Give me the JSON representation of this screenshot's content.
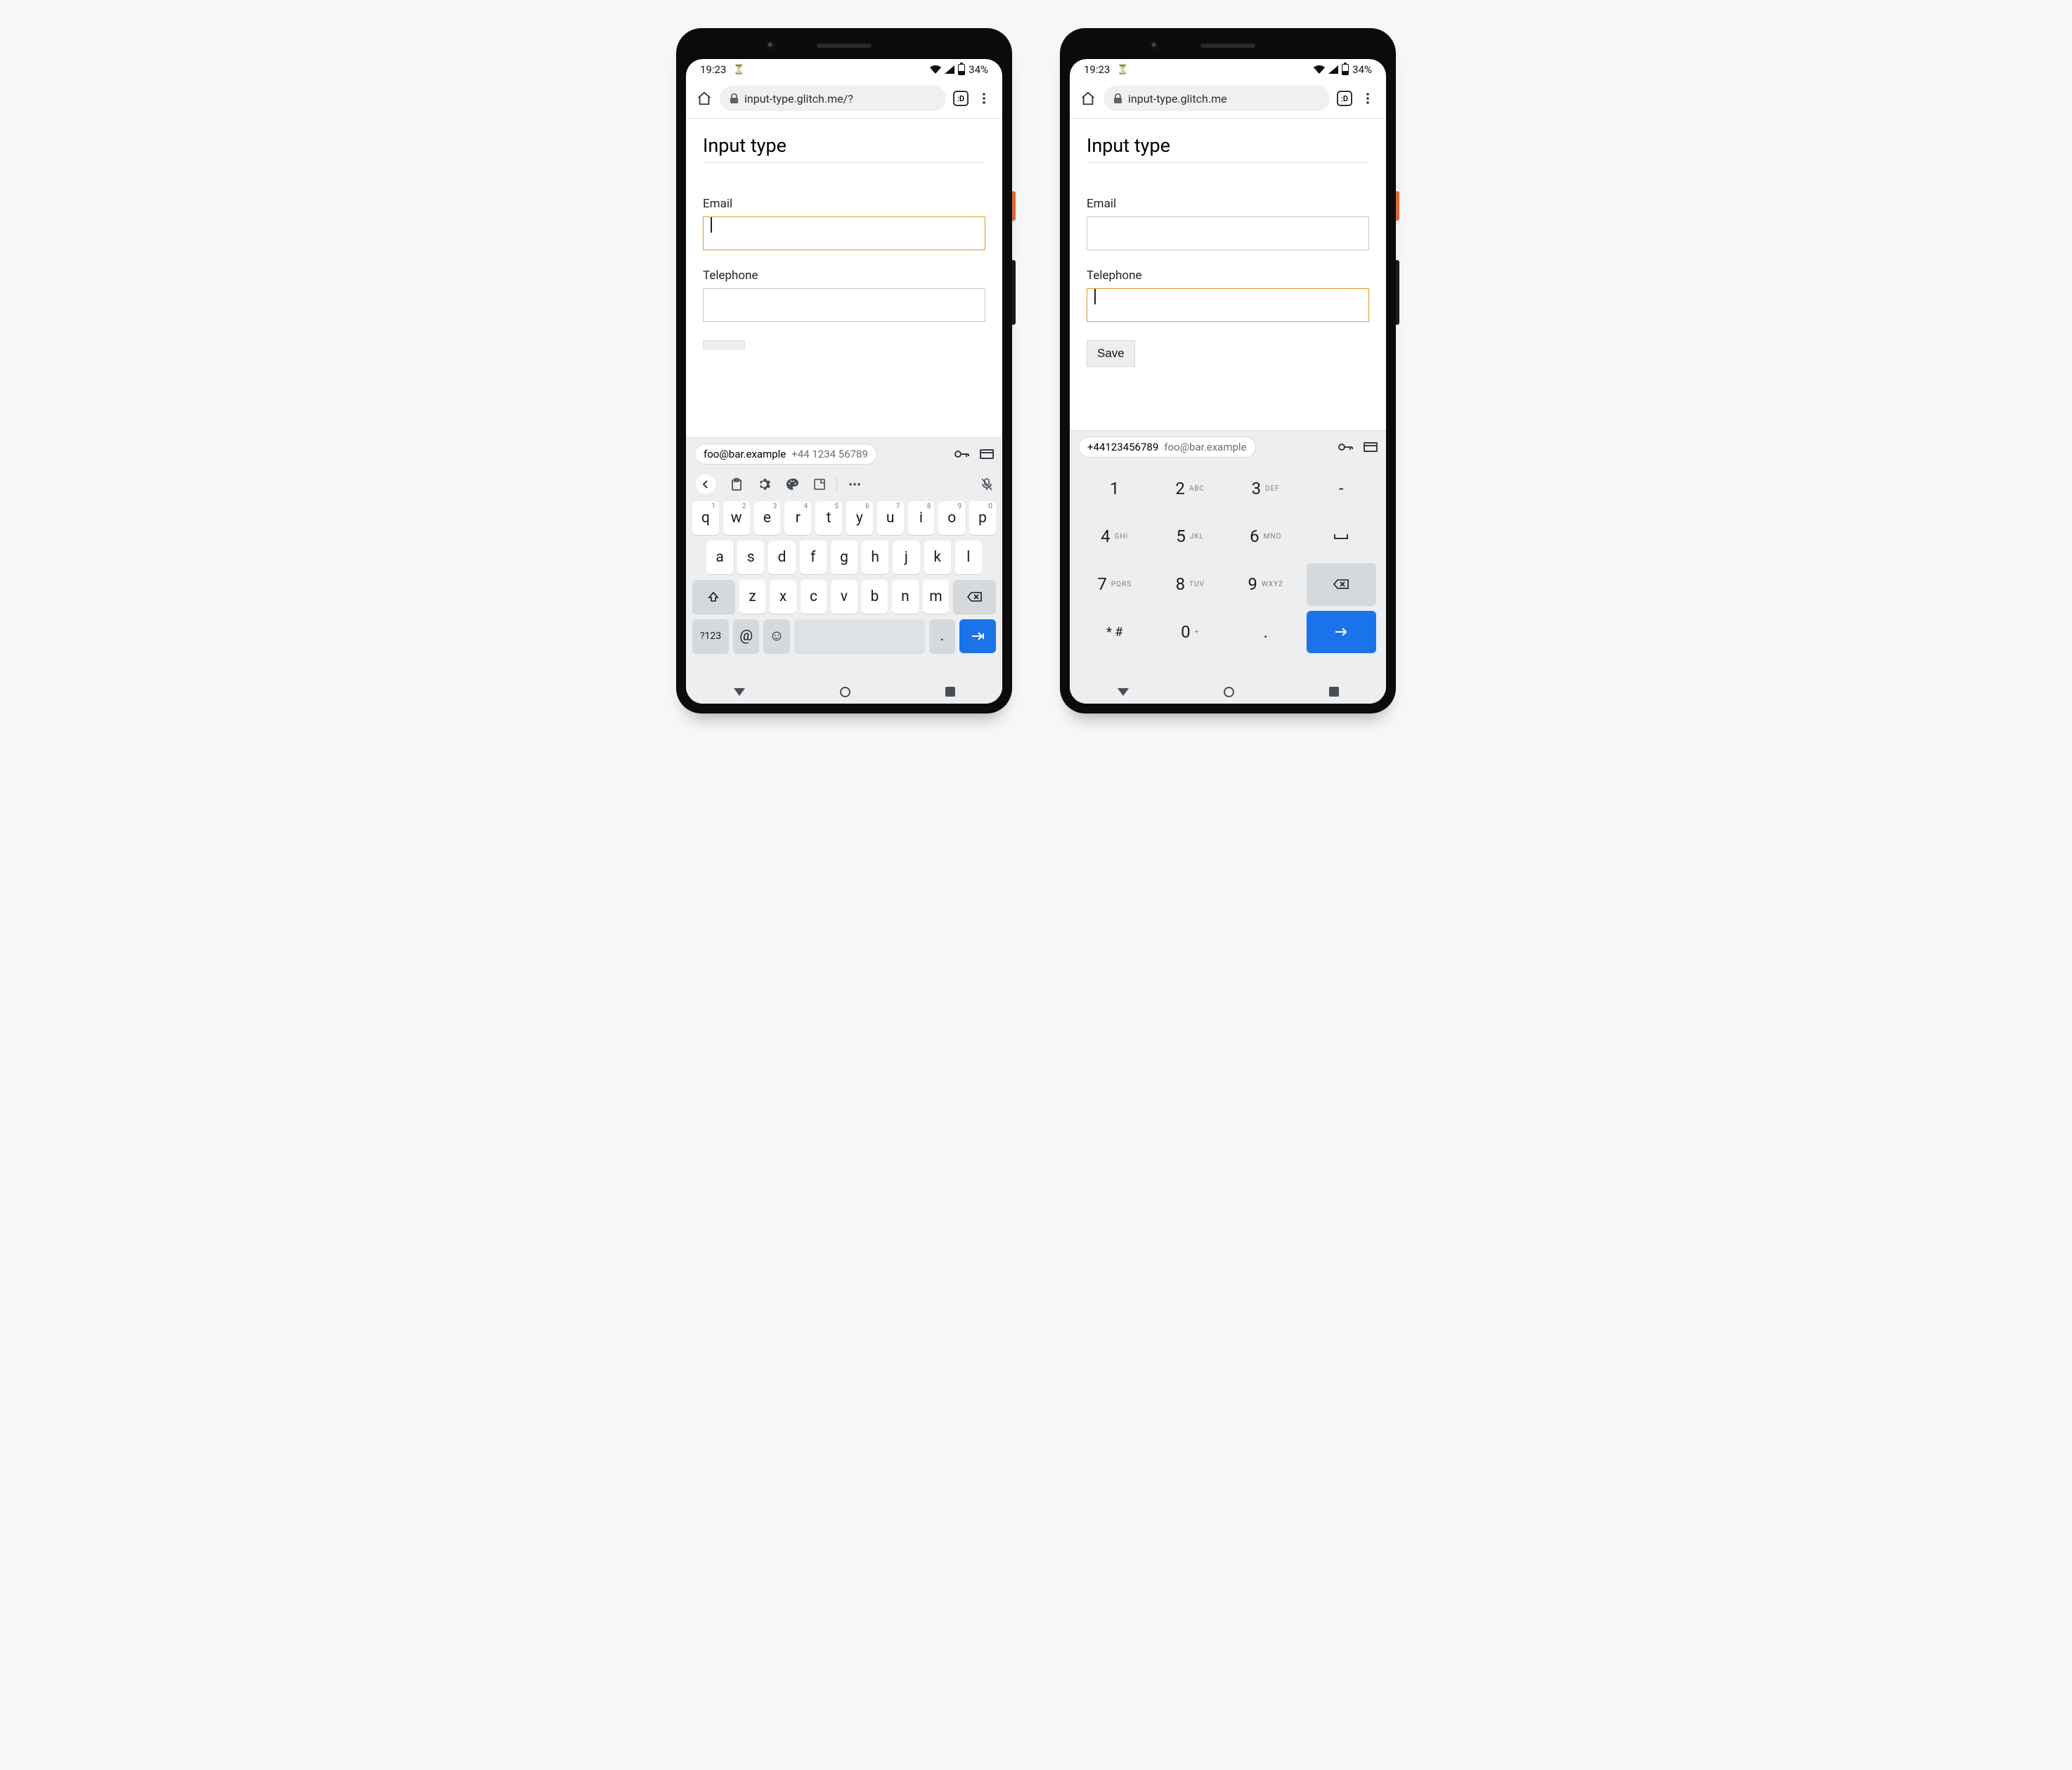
{
  "status": {
    "time": "19:23",
    "battery_pct": "34%"
  },
  "browser": {
    "url_left": "input-type.glitch.me/?",
    "url_right": "input-type.glitch.me",
    "tab_badge": ":D"
  },
  "page": {
    "title": "Input type",
    "email_label": "Email",
    "telephone_label": "Telephone",
    "save_label": "Save"
  },
  "autofill": {
    "email": "foo@bar.example",
    "phone": "+44 1234 56789",
    "phone_compact": "+44123456789"
  },
  "qwerty": {
    "row1": [
      "q",
      "w",
      "e",
      "r",
      "t",
      "y",
      "u",
      "i",
      "o",
      "p"
    ],
    "row1_hints": [
      "1",
      "2",
      "3",
      "4",
      "5",
      "6",
      "7",
      "8",
      "9",
      "0"
    ],
    "row2": [
      "a",
      "s",
      "d",
      "f",
      "g",
      "h",
      "j",
      "k",
      "l"
    ],
    "row3": [
      "z",
      "x",
      "c",
      "v",
      "b",
      "n",
      "m"
    ],
    "sym_key": "?123",
    "at_key": "@",
    "period_key": "."
  },
  "dialpad": {
    "keys": [
      {
        "n": "1",
        "s": ""
      },
      {
        "n": "2",
        "s": "ABC"
      },
      {
        "n": "3",
        "s": "DEF"
      },
      {
        "n": "4",
        "s": "GHI"
      },
      {
        "n": "5",
        "s": "JKL"
      },
      {
        "n": "6",
        "s": "MNO"
      },
      {
        "n": "7",
        "s": "PQRS"
      },
      {
        "n": "8",
        "s": "TUV"
      },
      {
        "n": "9",
        "s": "WXYZ"
      }
    ],
    "star": "* #",
    "zero": "0",
    "plus": "+",
    "dot": "."
  }
}
